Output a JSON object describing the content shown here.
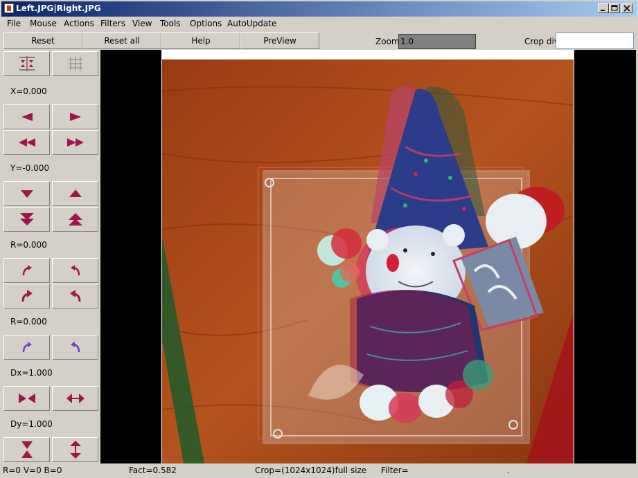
{
  "window": {
    "title": "Left.JPG|Right.JPG",
    "controls": [
      "minimize-icon",
      "maximize-icon",
      "close-icon"
    ]
  },
  "menu": [
    "File",
    "Mouse",
    "Actions",
    "Filters",
    "View",
    "Tools",
    "Options",
    "AutoUpdate"
  ],
  "toolbar": {
    "reset": "Reset",
    "reset_all": "Reset all",
    "help": "Help",
    "preview": "PreView",
    "zoom_label": "Zoom",
    "zoom_value": "1.0",
    "crop_label": "Crop div",
    "crop_value": ""
  },
  "side": {
    "x_value": "X=0.000",
    "y_value": "Y=-0.000",
    "r1_value": "R=0.000",
    "r2_value": "R=0.000",
    "dx_value": "Dx=1.000",
    "dy_value": "Dy=1.000",
    "icons": {
      "align_columns": "align-columns-icon",
      "grid_align": "grid-align-icon",
      "left": "arrow-left-icon",
      "right": "arrow-right-icon",
      "fast_left": "fast-left-icon",
      "fast_right": "fast-right-icon",
      "down": "arrow-down-icon",
      "up": "arrow-up-icon",
      "fast_down": "fast-down-icon",
      "fast_up": "fast-up-icon",
      "rotate_cw": "rotate-cw-icon",
      "rotate_ccw": "rotate-ccw-icon",
      "rotate_cw_fast": "rotate-cw-fast-icon",
      "rotate_ccw_fast": "rotate-ccw-fast-icon",
      "rotate_cw_fine": "rotate-cw-fine-icon",
      "rotate_ccw_fine": "rotate-ccw-fine-icon",
      "shrink_h": "shrink-horizontal-icon",
      "expand_h": "expand-horizontal-icon",
      "shrink_v": "shrink-vertical-icon",
      "expand_v": "expand-vertical-icon"
    }
  },
  "status": {
    "rvb": "R=0 V=0 B=0",
    "fact": "Fact=0.582",
    "crop": "Crop=(1024x1024)full size",
    "filter": "Filter=",
    "dot": "."
  },
  "colors": {
    "button_arrow": "#a0154a",
    "button_arrow_fine": "#6a3fd6",
    "title_start": "#0a246a",
    "title_end": "#a6caf0"
  }
}
